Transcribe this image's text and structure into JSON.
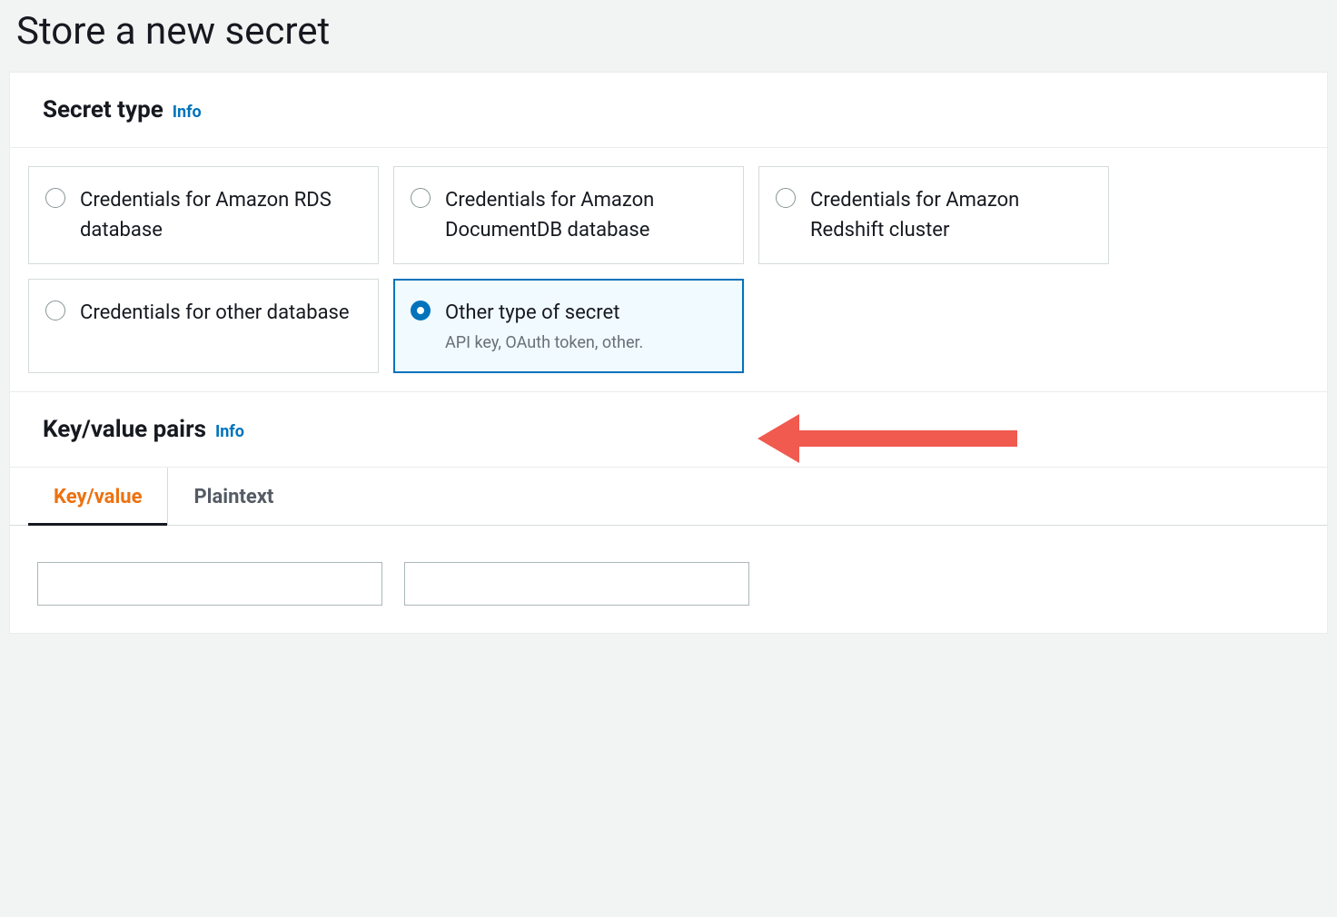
{
  "page": {
    "title": "Store a new secret"
  },
  "secretType": {
    "heading": "Secret type",
    "infoLabel": "Info",
    "options": [
      {
        "label": "Credentials for Amazon RDS database",
        "sublabel": "",
        "selected": false
      },
      {
        "label": "Credentials for Amazon DocumentDB database",
        "sublabel": "",
        "selected": false
      },
      {
        "label": "Credentials for Amazon Redshift cluster",
        "sublabel": "",
        "selected": false
      },
      {
        "label": "Credentials for other database",
        "sublabel": "",
        "selected": false
      },
      {
        "label": "Other type of secret",
        "sublabel": "API key, OAuth token, other.",
        "selected": true
      }
    ]
  },
  "keyValue": {
    "heading": "Key/value pairs",
    "infoLabel": "Info",
    "tabs": {
      "keyValue": "Key/value",
      "plaintext": "Plaintext"
    },
    "inputs": {
      "keyValue": "",
      "valueValue": ""
    }
  }
}
